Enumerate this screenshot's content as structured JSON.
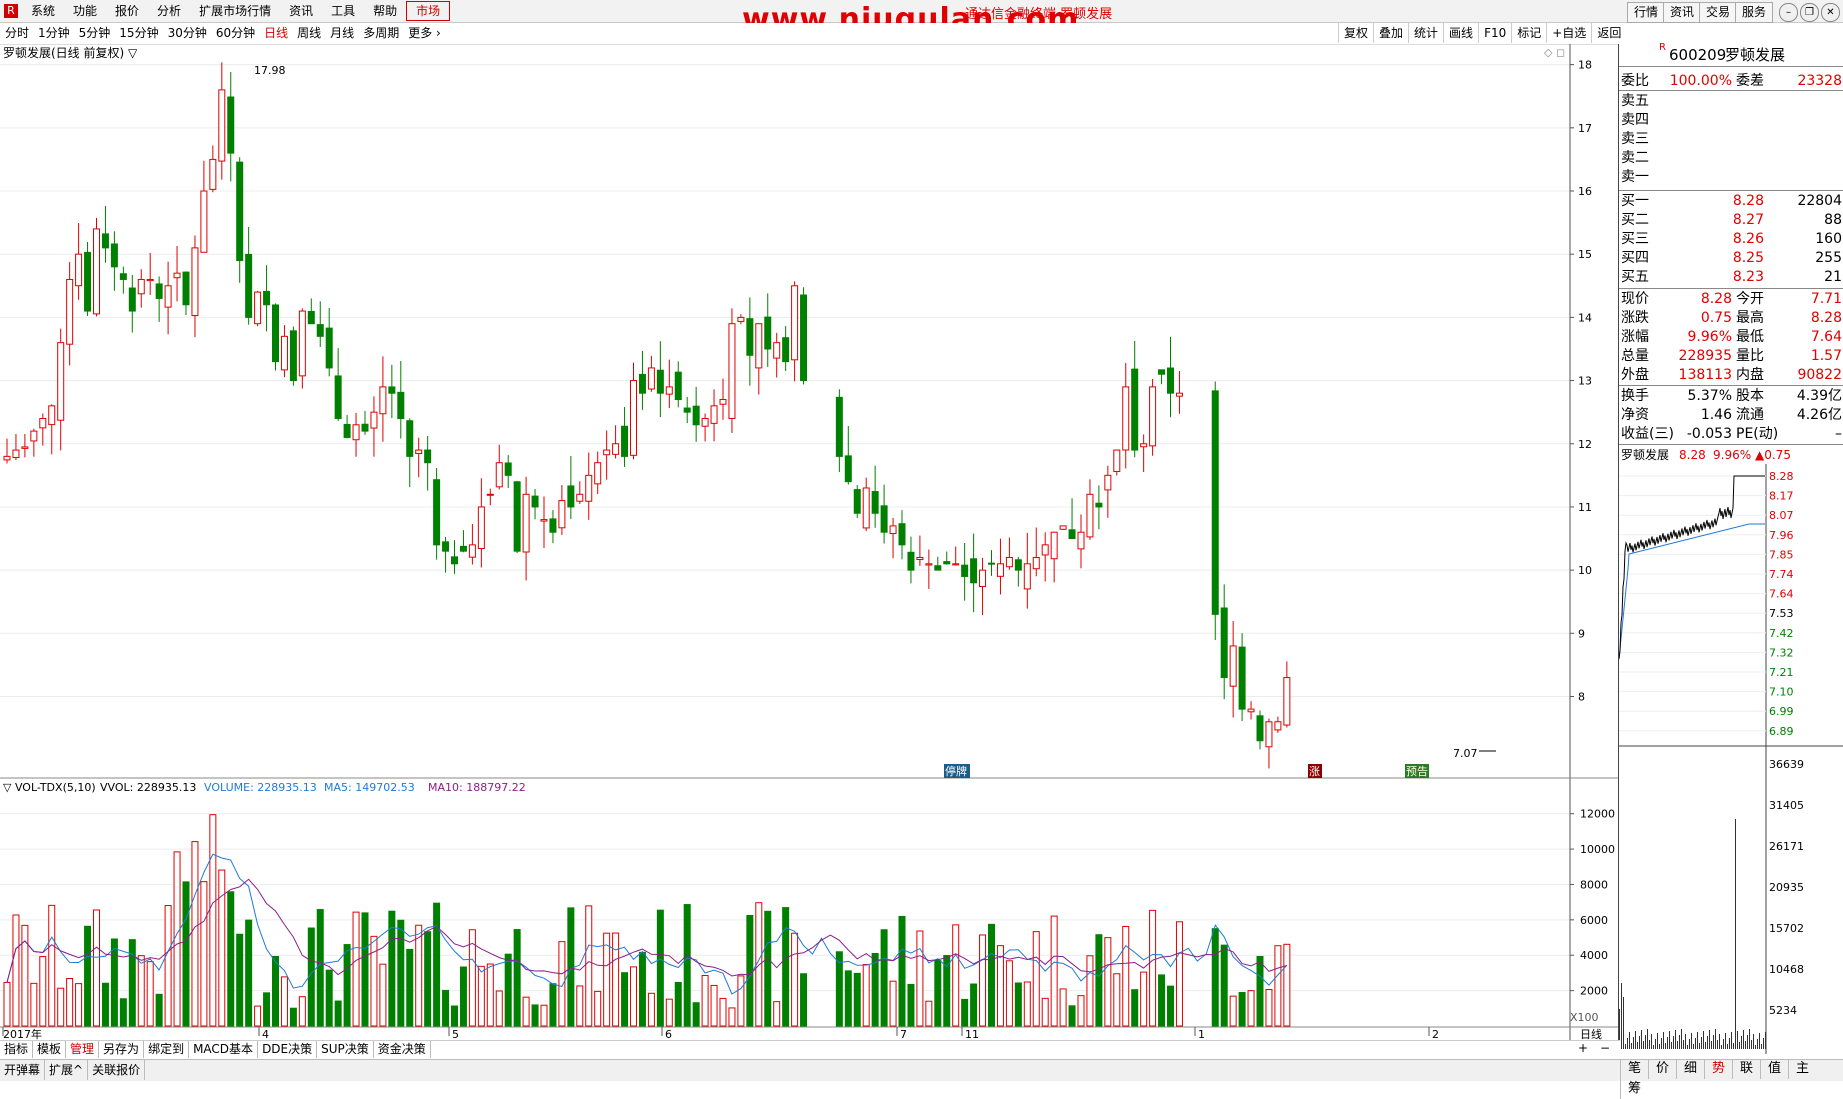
{
  "menu": {
    "logo": "R",
    "items": [
      "系统",
      "功能",
      "报价",
      "分析",
      "扩展市场行情",
      "资讯",
      "工具",
      "帮助"
    ],
    "market": "市场",
    "watermark": "www.niugulan.com",
    "subtitle": "通达信金融终端  罗顿发展",
    "right_buttons": [
      "行情",
      "资讯",
      "交易",
      "服务"
    ]
  },
  "periods": {
    "items": [
      "分时",
      "1分钟",
      "5分钟",
      "15分钟",
      "30分钟",
      "60分钟",
      "日线",
      "周线",
      "月线",
      "多周期",
      "更多 ›"
    ],
    "selected_index": 6
  },
  "right_tools": [
    "复权",
    "叠加",
    "统计",
    "画线",
    "F10",
    "标记",
    "+自选",
    "返回"
  ],
  "kline": {
    "title": "罗顿发展(日线 前复权) ▽",
    "max_price": "17.98",
    "min_price": "7.07",
    "y_ticks": [
      18,
      17,
      16,
      15,
      14,
      13,
      12,
      11,
      10,
      9,
      8
    ],
    "ymin": 6.9,
    "ymax": 18.2,
    "markers": [
      "停牌",
      "涨",
      "预告"
    ]
  },
  "volume": {
    "title": "▽ VOL-TDX(5,10)",
    "vvol": "VVOL: 228935.13",
    "vol": "VOLUME: 228935.13",
    "ma5": "MA5: 149702.53",
    "ma10": "MA10: 188797.22",
    "y_ticks": [
      12000,
      10000,
      8000,
      6000,
      4000,
      2000
    ],
    "unit": "X100",
    "ymax": 13000
  },
  "time_axis": {
    "labels": [
      "2017年",
      "4",
      "5",
      "6",
      "7",
      "11",
      "1",
      "2"
    ],
    "period": "日线"
  },
  "bottom_tabs": [
    "指标",
    "模板",
    "管理",
    "另存为",
    "绑定到",
    "MACD基本",
    "DDE决策",
    "SUP决策",
    "资金决策"
  ],
  "bottom_tabs_selected": 2,
  "status_bar": [
    "开弹幕",
    "扩展^",
    "关联报价"
  ],
  "right_tabs": [
    "笔",
    "价",
    "细",
    "势",
    "联",
    "值",
    "主",
    "筹"
  ],
  "right_tabs_selected": 3,
  "colors": {
    "up": "#e00000",
    "down": "#008000",
    "ma5": "#1e7bd6",
    "ma10": "#8b1e8b"
  },
  "quote": {
    "code": "600209",
    "name": "罗顿发展",
    "r_badge": "R",
    "wei_bi_label": "委比",
    "wei_bi": "100.00%",
    "wei_cha_label": "委差",
    "wei_cha": "23328",
    "sell_labels": [
      "卖五",
      "卖四",
      "卖三",
      "卖二",
      "卖一"
    ],
    "buy": [
      {
        "label": "买一",
        "price": "8.28",
        "vol": "22804"
      },
      {
        "label": "买二",
        "price": "8.27",
        "vol": "88"
      },
      {
        "label": "买三",
        "price": "8.26",
        "vol": "160"
      },
      {
        "label": "买四",
        "price": "8.25",
        "vol": "255"
      },
      {
        "label": "买五",
        "price": "8.23",
        "vol": "21"
      }
    ],
    "stats": [
      {
        "l1": "现价",
        "v1": "8.28",
        "l2": "今开",
        "v2": "7.71"
      },
      {
        "l1": "涨跌",
        "v1": "0.75",
        "l2": "最高",
        "v2": "8.28"
      },
      {
        "l1": "涨幅",
        "v1": "9.96%",
        "l2": "最低",
        "v2": "7.64"
      },
      {
        "l1": "总量",
        "v1": "228935",
        "l2": "量比",
        "v2": "1.57"
      },
      {
        "l1": "外盘",
        "v1": "138113",
        "l2": "内盘",
        "v2": "90822"
      }
    ],
    "stats2": [
      {
        "l1": "换手",
        "v1": "5.37%",
        "l2": "股本",
        "v2": "4.39亿"
      },
      {
        "l1": "净资",
        "v1": "1.46",
        "l2": "流通",
        "v2": "4.26亿"
      },
      {
        "l1": "收益(三)",
        "v1": "-0.053",
        "l2": "PE(动)",
        "v2": "–"
      }
    ],
    "mini_title": "罗顿发展",
    "mini_price": "8.28",
    "mini_pct": "9.96%",
    "mini_chg": "▲0.75",
    "mini_price_ticks": [
      "8.28",
      "8.17",
      "8.07",
      "7.96",
      "7.85",
      "7.74",
      "7.64",
      "7.53",
      "7.42",
      "7.32",
      "7.21",
      "7.10",
      "6.99",
      "6.89"
    ],
    "mini_vol_ticks": [
      "36639",
      "31405",
      "26171",
      "20935",
      "15702",
      "10468",
      "5234"
    ]
  }
}
